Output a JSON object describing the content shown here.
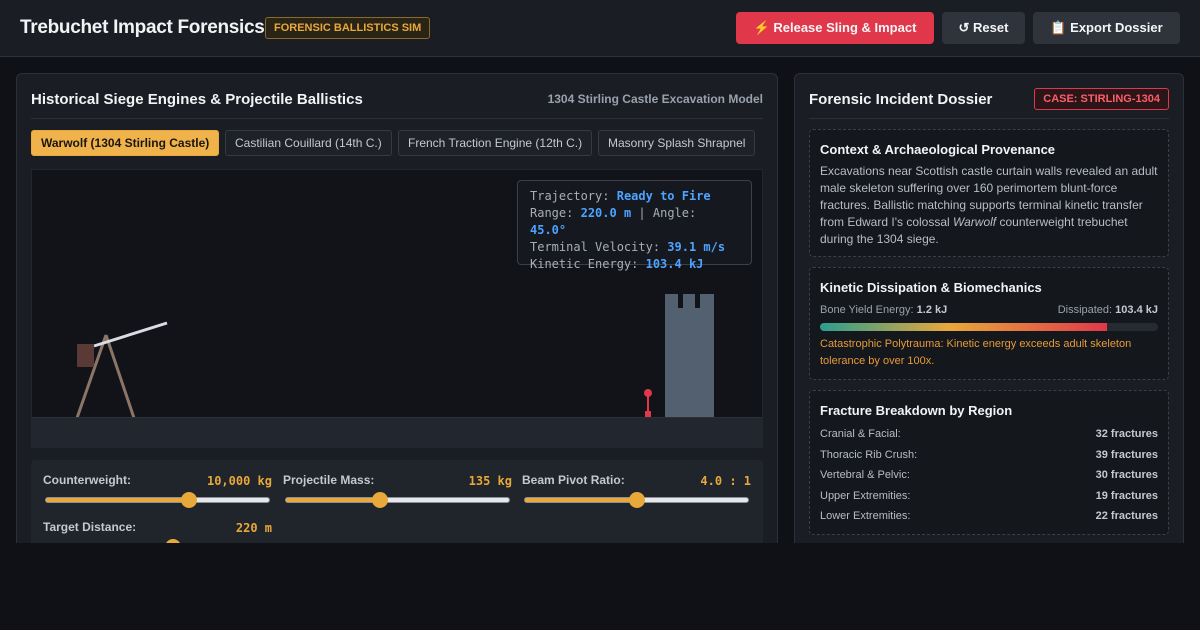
{
  "header": {
    "title": "Trebuchet Impact Forensics",
    "badge": "FORENSIC BALLISTICS SIM",
    "release_label": "⚡ Release Sling & Impact",
    "reset_label": "↺ Reset",
    "export_label": "📋 Export Dossier"
  },
  "left_panel": {
    "title": "Historical Siege Engines & Projectile Ballistics",
    "subtitle": "1304 Stirling Castle Excavation Model",
    "tabs": [
      {
        "label": "Warwolf (1304 Stirling Castle)",
        "active": true
      },
      {
        "label": "Castilian Couillard (14th C.)",
        "active": false
      },
      {
        "label": "French Traction Engine (12th C.)",
        "active": false
      },
      {
        "label": "Masonry Splash Shrapnel",
        "active": false
      }
    ],
    "readout": {
      "trajectory_label": "Trajectory:",
      "trajectory_value": "Ready to Fire",
      "range_label": "Range:",
      "range_value": "220.0 m",
      "separator": "|",
      "angle_label": "Angle:",
      "angle_value": "45.0°",
      "velocity_label": "Terminal Velocity:",
      "velocity_value": "39.1 m/s",
      "energy_label": "Kinetic Energy:",
      "energy_value": "103.4 kJ"
    },
    "controls": [
      {
        "label": "Counterweight:",
        "value": "10,000 kg",
        "level": 0.64
      },
      {
        "label": "Projectile Mass:",
        "value": "135 kg",
        "level": 0.42
      },
      {
        "label": "Beam Pivot Ratio:",
        "value": "4.0 : 1",
        "level": 0.5
      },
      {
        "label": "Target Distance:",
        "value": "220 m",
        "level": 0.57
      }
    ]
  },
  "right_panel": {
    "title": "Forensic Incident Dossier",
    "case_badge": "CASE: STIRLING-1304",
    "context": {
      "title": "Context & Archaeological Provenance",
      "text_before": "Excavations near Scottish castle curtain walls revealed an adult male skeleton suffering over 160 perimortem blunt-force fractures. Ballistic matching supports terminal kinetic transfer from Edward I's colossal ",
      "text_italic": "Warwolf",
      "text_after": " counterweight trebuchet during the 1304 siege."
    },
    "kinetic": {
      "title": "Kinetic Dissipation & Biomechanics",
      "yield_label": "Bone Yield Energy:",
      "yield_value": "1.2 kJ",
      "dissipated_label": "Dissipated:",
      "dissipated_value": "103.4 kJ",
      "fill_fraction": 0.85,
      "warning": "Catastrophic Polytrauma: Kinetic energy exceeds adult skeleton tolerance by over 100x."
    },
    "fractures": {
      "title": "Fracture Breakdown by Region",
      "rows": [
        {
          "region": "Cranial & Facial:",
          "count": "32 fractures"
        },
        {
          "region": "Thoracic Rib Crush:",
          "count": "39 fractures"
        },
        {
          "region": "Vertebral & Pelvic:",
          "count": "30 fractures"
        },
        {
          "region": "Upper Extremities:",
          "count": "19 fractures"
        },
        {
          "region": "Lower Extremities:",
          "count": "22 fractures"
        }
      ]
    }
  },
  "colors": {
    "accent": "#e8a83a",
    "danger": "#e0384a",
    "info": "#4da3ff",
    "background": "#0f1116"
  }
}
